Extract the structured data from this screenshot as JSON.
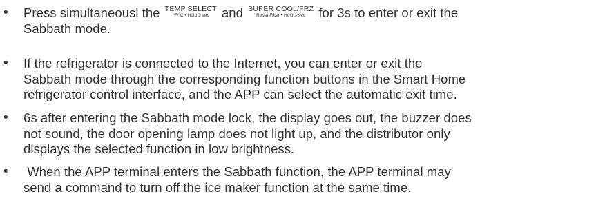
{
  "bullets": [
    {
      "marker": "•",
      "prefix": "Press simultaneousl the",
      "label_temp": {
        "main": "TEMP SELECT",
        "sub": "°F/°C • Hold 3 sec"
      },
      "joiner": "and",
      "label_cool": {
        "main": "SUPER COOL/FRZ",
        "sub": "Reset Filter • Hold 3 sec"
      },
      "suffix": "for 3s to enter or exit the",
      "line2": "Sabbath mode."
    },
    {
      "marker": "•",
      "lines": [
        "If the refrigerator is connected to the Internet, you can enter or exit the",
        "Sabbath mode through the corresponding function buttons in the Smart Home",
        "refrigerator control interface, and the APP can select the automatic exit time."
      ]
    },
    {
      "marker": "•",
      "lines": [
        "6s after entering the Sabbath mode lock, the display goes out, the buzzer does",
        "not sound, the door opening lamp does not light up, and the distributor only",
        "displays the selected function in low brightness."
      ]
    },
    {
      "marker": "•",
      "lines": [
        " When the APP terminal enters the Sabbath function, the APP terminal may",
        "send a command to turn off the ice maker function at the same time."
      ]
    }
  ]
}
